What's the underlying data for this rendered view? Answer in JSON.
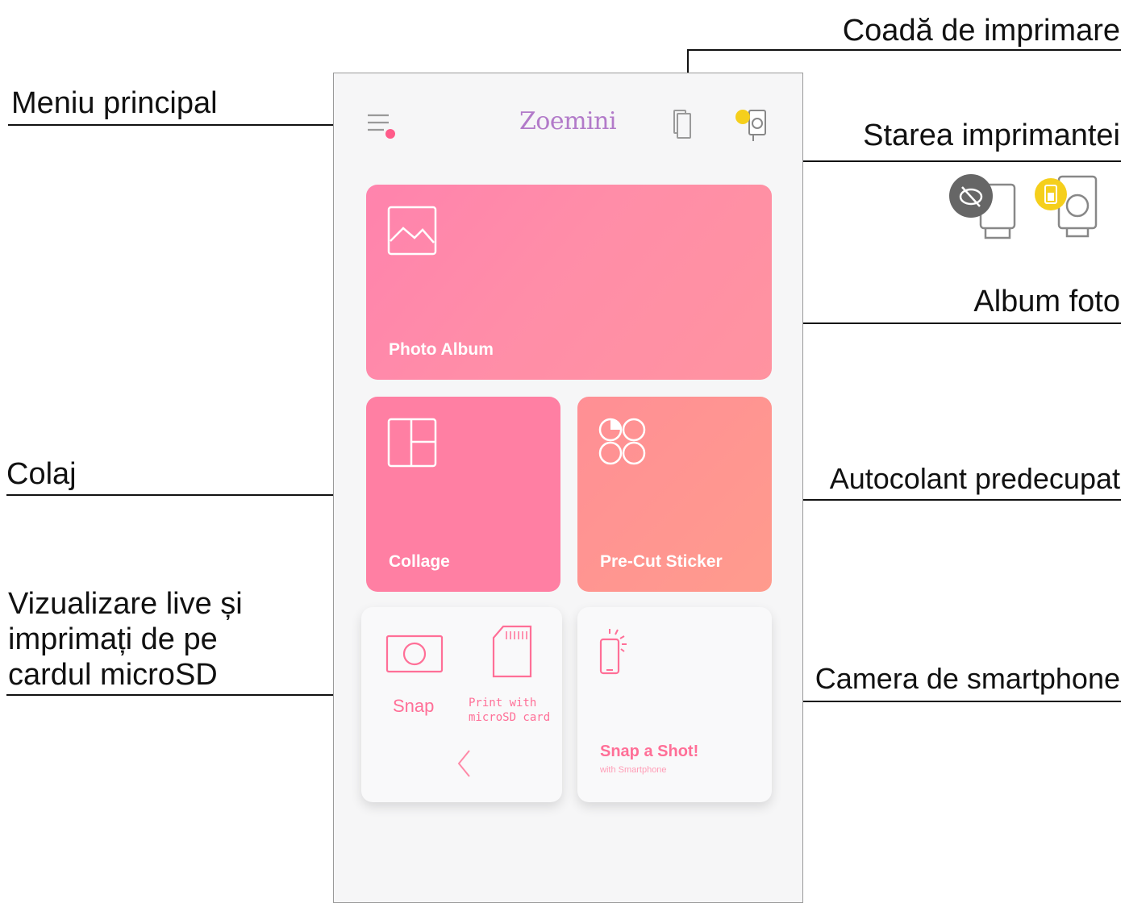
{
  "callouts": {
    "queue": "Coadă de imprimare",
    "main_menu": "Meniu principal",
    "printer_status": "Starea imprimantei",
    "photo_album": "Album foto",
    "collage": "Colaj",
    "sticker": "Autocolant predecupat",
    "live_view_line1": "Vizualizare live și",
    "live_view_line2": "imprimați de pe",
    "live_view_line3": "cardul microSD",
    "smartphone_camera": "Camera de smartphone"
  },
  "app": {
    "logo": "Zoemini",
    "tiles": {
      "photo_album": "Photo Album",
      "collage": "Collage",
      "sticker": "Pre-Cut Sticker"
    },
    "snap_card": {
      "snap": "Snap",
      "print_line1": "Print with",
      "print_line2": "microSD card",
      "back": "<"
    },
    "shot_card": {
      "title": "Snap a Shot!",
      "subtitle": "with Smartphone"
    }
  },
  "colors": {
    "album": "#ff8da8",
    "collage": "#ff7fa3",
    "sticker": "#ff978f",
    "accent": "#ff6f97",
    "logo": "#b27ac9",
    "battery": "#f5cf1c"
  },
  "icons": [
    "menu-icon",
    "print-queue-icon",
    "printer-status-icon",
    "disconnected-printer-icon",
    "battery-printer-icon",
    "image-icon",
    "collage-layout-icon",
    "sticker-circles-icon",
    "camera-icon",
    "sd-card-icon",
    "back-arrow-icon",
    "smartphone-icon"
  ]
}
